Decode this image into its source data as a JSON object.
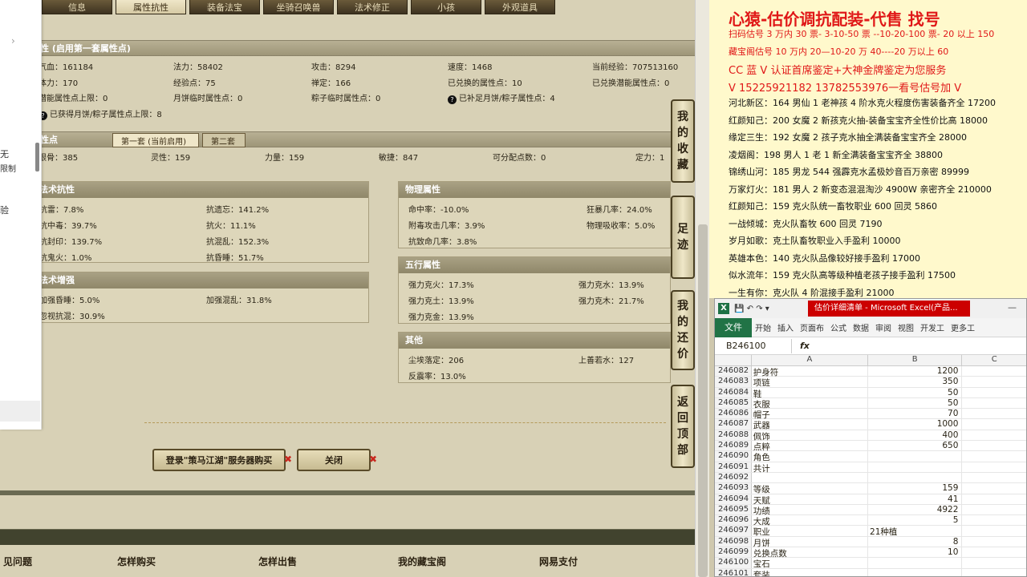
{
  "left_panel": {
    "lines": [
      "无",
      "限制",
      "验"
    ]
  },
  "tabs": [
    {
      "label": "信息",
      "active": false
    },
    {
      "label": "属性抗性",
      "active": true
    },
    {
      "label": "装备法宝",
      "active": false
    },
    {
      "label": "坐骑召唤兽",
      "active": false
    },
    {
      "label": "法术修正",
      "active": false
    },
    {
      "label": "小孩",
      "active": false
    },
    {
      "label": "外观道具",
      "active": false
    }
  ],
  "attr_section": {
    "title": "性 (启用第一套属性点)",
    "rows": [
      [
        "气血：161184",
        "法力：58402",
        "攻击：8294",
        "速度：1468",
        "当前经验：707513160"
      ],
      [
        "体力：170",
        "经验点：75",
        "禅定：166",
        "已兑换的属性点：10",
        "已兑换潜能属性点：0"
      ],
      [
        "潜能属性点上限：0",
        "月饼临时属性点：0",
        "粽子临时属性点：0",
        "已补足月饼/粽子属性点：4",
        ""
      ]
    ],
    "note": "已获得月饼/粽子属性点上限：8"
  },
  "points_section": {
    "title": "性点",
    "subtabs": [
      "第一套 (当前启用)",
      "第二套"
    ],
    "values": [
      "根骨：385",
      "灵性：159",
      "力量：159",
      "敏捷：847",
      "可分配点数：0",
      "定力：1"
    ]
  },
  "resist": {
    "title": "法术抗性",
    "items": [
      "抗雷：7.8%",
      "抗遗忘：141.2%",
      "抗中毒：39.7%",
      "抗火：11.1%",
      "抗封印：139.7%",
      "抗混乱：152.3%",
      "抗鬼火：1.0%",
      "抗昏睡：51.7%"
    ]
  },
  "enhance": {
    "title": "法术增强",
    "items": [
      "加强昏睡：5.0%",
      "加强混乱：31.8%",
      "忽视抗混：30.9%"
    ]
  },
  "physical": {
    "title": "物理属性",
    "items": [
      "命中率：-10.0%",
      "狂暴几率：24.0%",
      "附毒攻击几率：3.9%",
      "物理吸收率：5.0%",
      "抗致命几率：3.8%"
    ]
  },
  "elements": {
    "title": "五行属性",
    "items": [
      "强力克火：17.3%",
      "强力克水：13.9%",
      "强力克土：13.9%",
      "强力克木：21.7%",
      "强力克金：13.9%"
    ]
  },
  "other": {
    "title": "其他",
    "items": [
      "尘埃落定：206",
      "上善若水：127",
      "反震率：13.0%"
    ]
  },
  "side_buttons": [
    [
      "我",
      "的",
      "收",
      "藏"
    ],
    [
      "足",
      "迹"
    ],
    [
      "我",
      "的",
      "还",
      "价"
    ],
    [
      "返",
      "回",
      "顶",
      "部"
    ]
  ],
  "buttons": {
    "login": "登录\"策马江湖\"服务器购买",
    "close": "关闭",
    "x": "✖"
  },
  "footer_nav": [
    "见问题",
    "怎样购买",
    "怎样出售",
    "我的藏宝阁",
    "网易支付"
  ],
  "ad": {
    "title": "心猿-估价调抗配装-代售 找号",
    "red_lines": [
      "扫码估号 3 万内 30 票- 3-10-50 票 --10-20-100 票- 20 以上 150",
      "藏宝阁估号 10 万内 20—10-20 万 40----20 万以上 60",
      "CC 蓝 V 认证首席鉴定+大神金牌鉴定为您服务",
      "V 15225921182     13782553976一看号估号加 V"
    ],
    "lines": [
      "河北新区：164 男仙 1 老神孩 4 阶水克火程度伤害装备齐全 17200",
      "红颜知己：200 女魔 2 新孩克火抽-装备宝宝齐全性价比高 18000",
      "缘定三生：192 女魔 2 孩子克水抽全满装备宝宝齐全 28000",
      "凌烟阁：198 男人 1 老 1 新全满装备宝宝齐全 38800",
      "锦绣山河：185 男龙 544 强霹克水孟极妙音百万亲密 89999",
      "万家灯火：181 男人 2 新变态混混淘沙 4900W 亲密齐全 210000",
      "红颜知己：159 克火队统一畜牧职业 600 回灵 5860",
      "一战倾城：克火队畜牧 600 回灵 7190",
      "岁月如歌：克土队畜牧职业入手盈利 10000",
      "英雄本色：140 克火队品像较好接手盈利 17000",
      "似水流年：159 克火队高等级种植老孩子接手盈利 17500",
      "一生有你：克火队 4 阶混接手盈利 21000"
    ]
  },
  "excel": {
    "title": "估价详细清单 - Microsoft Excel(产品...",
    "ribbon": [
      "文件",
      "开始",
      "插入",
      "页面布",
      "公式",
      "数据",
      "审阅",
      "视图",
      "开发工",
      "更多工"
    ],
    "name_box": "B246100",
    "fx": "fx",
    "cols": [
      "A",
      "B",
      "C"
    ],
    "rows": [
      [
        "246082",
        "护身符",
        "1200"
      ],
      [
        "246083",
        "项链",
        "350"
      ],
      [
        "246084",
        "鞋",
        "50"
      ],
      [
        "246085",
        "衣服",
        "50"
      ],
      [
        "246086",
        "帽子",
        "70"
      ],
      [
        "246087",
        "武器",
        "1000"
      ],
      [
        "246088",
        "佩饰",
        "400"
      ],
      [
        "246089",
        "点粹",
        "650"
      ],
      [
        "246090",
        "角色",
        ""
      ],
      [
        "246091",
        "共计",
        ""
      ],
      [
        "246092",
        "",
        ""
      ],
      [
        "246093",
        "等级",
        "159"
      ],
      [
        "246094",
        "天赋",
        "41"
      ],
      [
        "246095",
        "功绩",
        "4922"
      ],
      [
        "246096",
        "大成",
        "5"
      ],
      [
        "246097",
        "职业",
        "21种植"
      ],
      [
        "246098",
        "月饼",
        "8"
      ],
      [
        "246099",
        "兑换点数",
        "10"
      ],
      [
        "246100",
        "宝石",
        ""
      ],
      [
        "246101",
        "套装",
        ""
      ]
    ]
  }
}
